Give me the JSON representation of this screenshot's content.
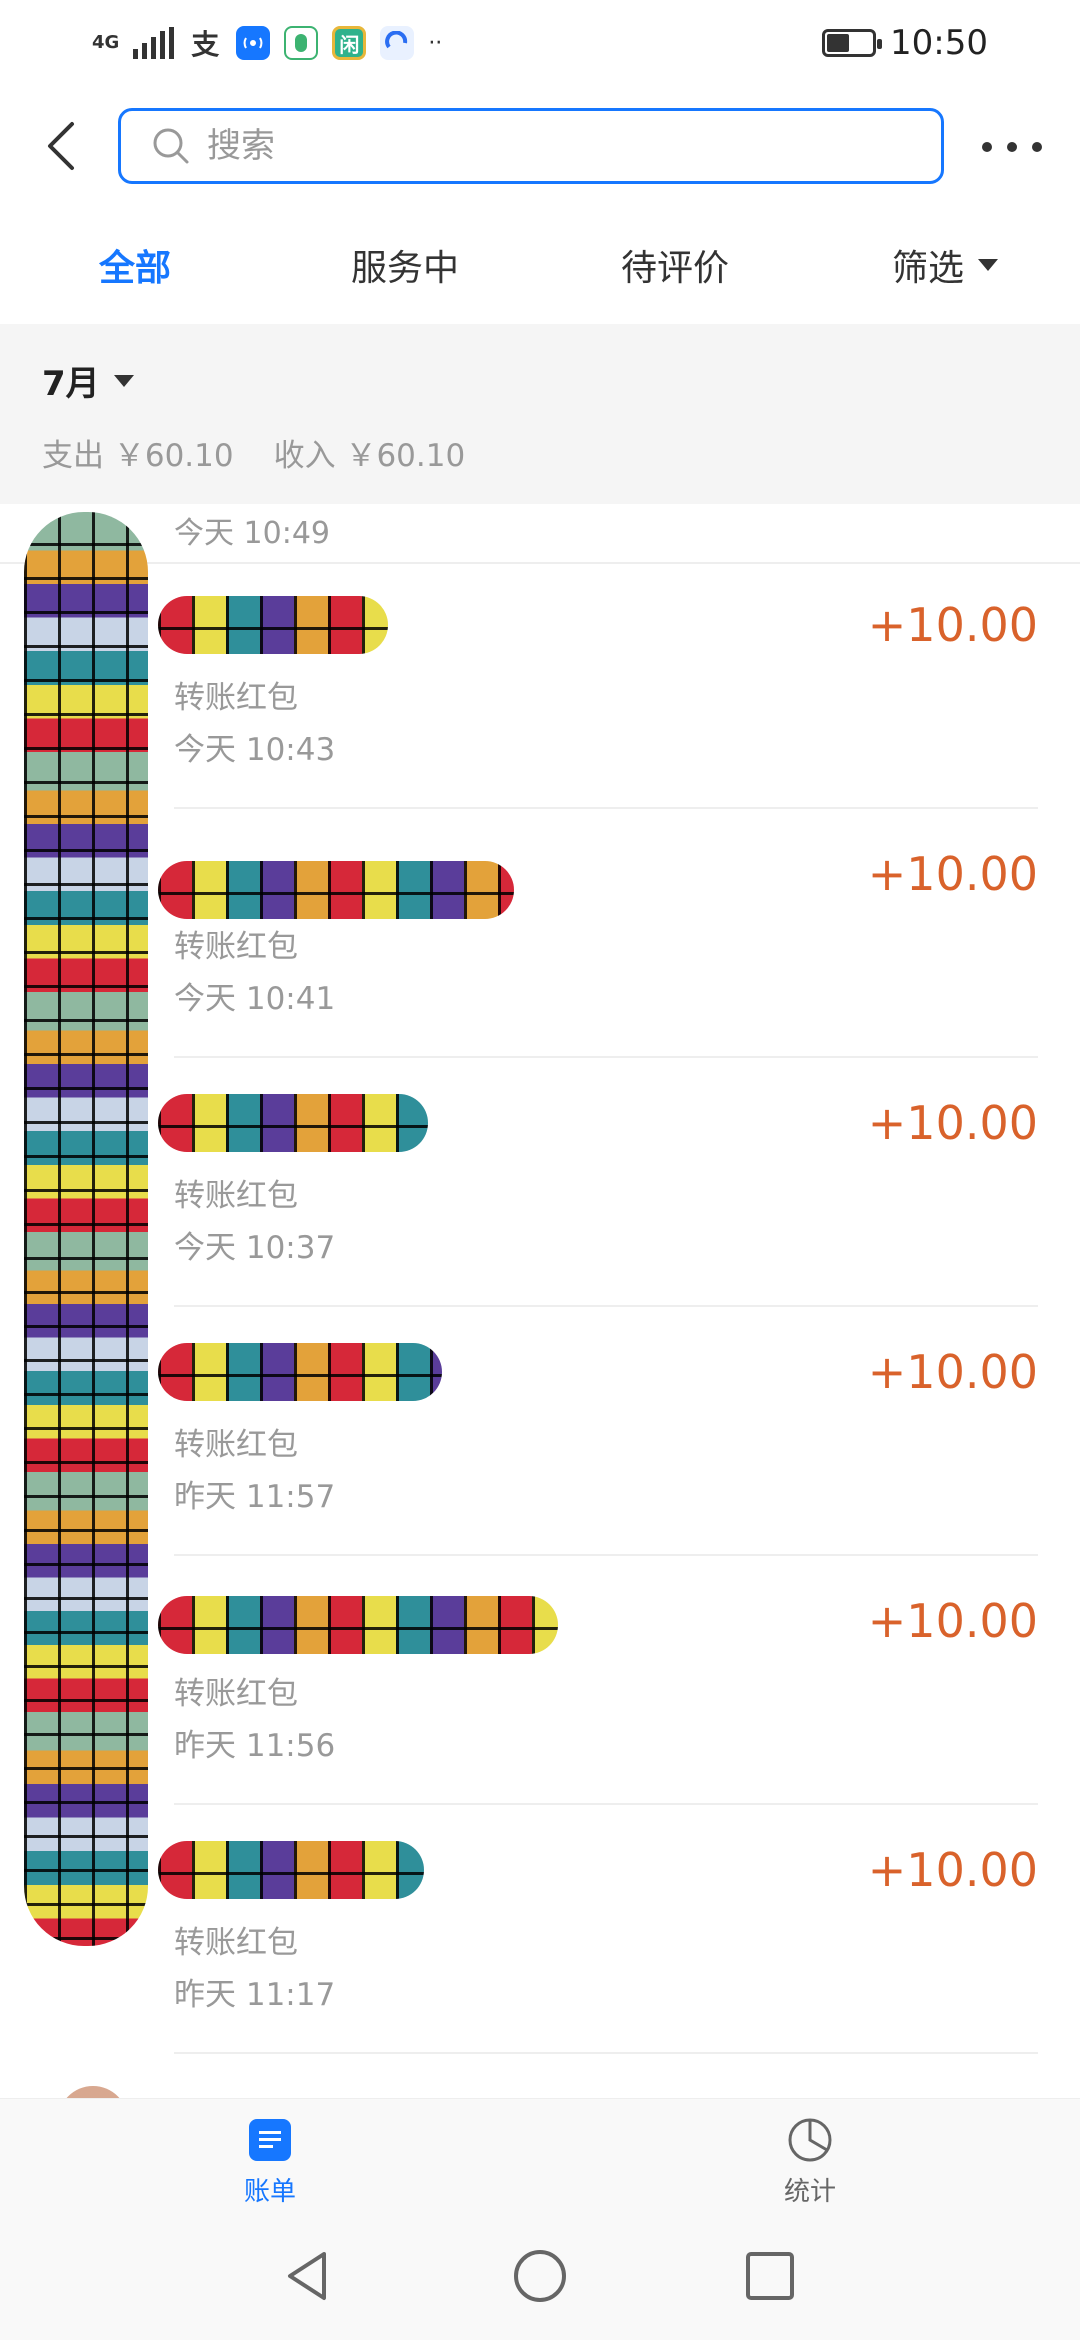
{
  "status_bar": {
    "network": "4G",
    "time": "10:50",
    "battery_level": 0.5,
    "mini_apps": [
      {
        "icon": "alipay-icon",
        "label": "支",
        "color": "#333333"
      },
      {
        "icon": "wifi-hotspot-icon",
        "label": "",
        "color": "#1677ff"
      },
      {
        "icon": "app-green-icon",
        "label": "",
        "color": "#3cb371"
      },
      {
        "icon": "xianyu-icon",
        "label": "闲",
        "color": "#2fb28c"
      },
      {
        "icon": "app-blue-icon",
        "label": "",
        "color": "#2b6ef2"
      }
    ]
  },
  "header": {
    "search_placeholder": "搜索"
  },
  "tabs": [
    {
      "label": "全部",
      "active": true
    },
    {
      "label": "服务中",
      "active": false
    },
    {
      "label": "待评价",
      "active": false
    },
    {
      "label": "筛选",
      "active": false
    }
  ],
  "month": {
    "label": "7月",
    "expense": "支出 ￥60.10",
    "income": "收入 ￥60.10"
  },
  "partial_row": {
    "time": "今天 10:49"
  },
  "records": [
    {
      "type": "转账红包",
      "time": "今天 10:43",
      "amount": "+10.00"
    },
    {
      "type": "转账红包",
      "time": "今天 10:41",
      "amount": "+10.00"
    },
    {
      "type": "转账红包",
      "time": "今天 10:37",
      "amount": "+10.00"
    },
    {
      "type": "转账红包",
      "time": "昨天 11:57",
      "amount": "+10.00"
    },
    {
      "type": "转账红包",
      "time": "昨天 11:56",
      "amount": "+10.00"
    },
    {
      "type": "转账红包",
      "time": "昨天 11:17",
      "amount": "+10.00"
    }
  ],
  "bottom_tabs": [
    {
      "label": "账单",
      "icon": "bill-icon",
      "active": true
    },
    {
      "label": "统计",
      "icon": "pie-chart-icon",
      "active": false
    }
  ],
  "colors": {
    "accent": "#1677ff",
    "amount": "#d9622b",
    "muted": "#999999"
  }
}
